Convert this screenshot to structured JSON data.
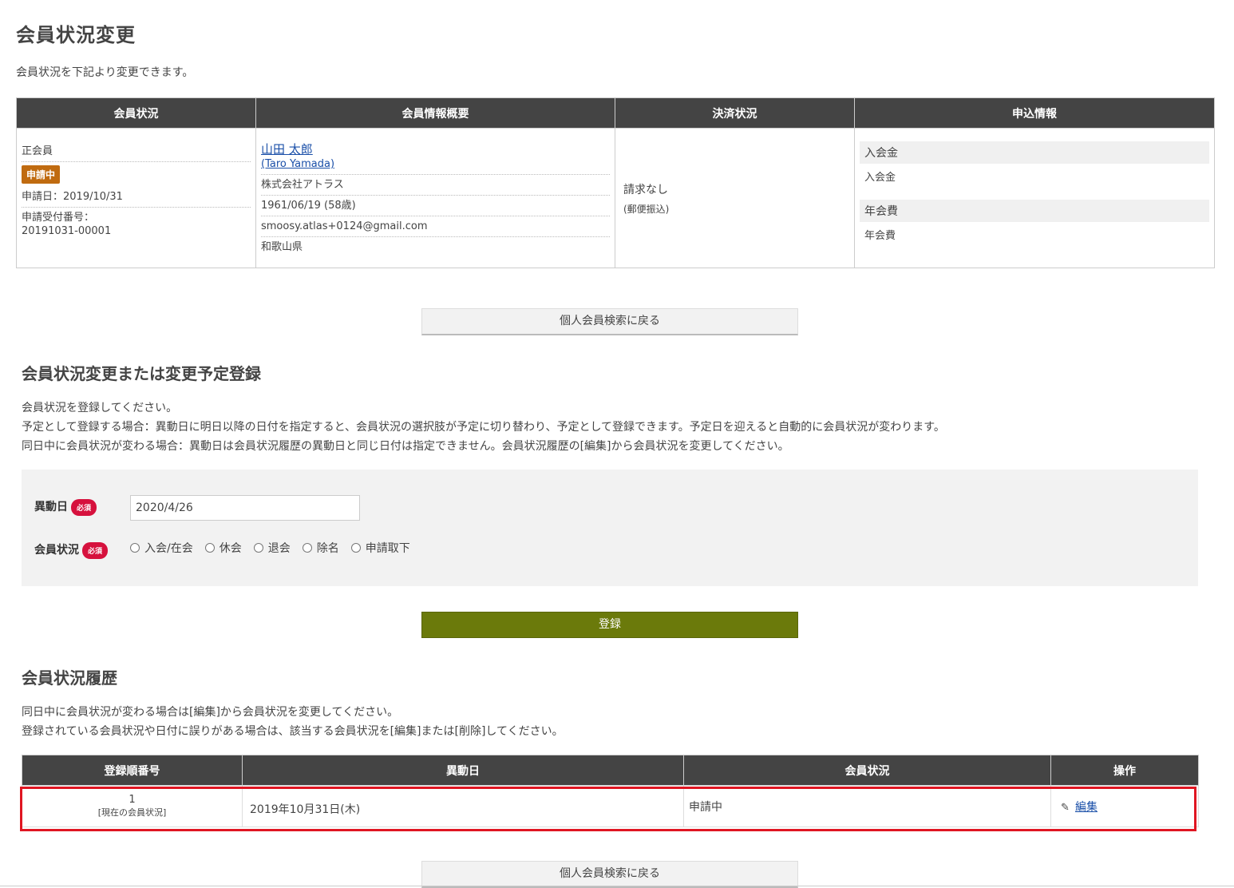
{
  "page": {
    "title": "会員状況変更",
    "description": "会員状況を下記より変更できます。"
  },
  "info_table": {
    "headers": [
      "会員状況",
      "会員情報概要",
      "決済状況",
      "申込情報"
    ],
    "status": {
      "type": "正会員",
      "badge": "申請中",
      "applied_date": "申請日：2019/10/31",
      "receipt_label": "申請受付番号：",
      "receipt_number": "20191031-00001"
    },
    "member": {
      "name": "山田 太郎",
      "name_en": "(Taro Yamada)",
      "company": "株式会社アトラス",
      "birth": "1961/06/19 (58歳)",
      "email": "smoosy.atlas+0124@gmail.com",
      "prefecture": "和歌山県"
    },
    "payment": {
      "status": "請求なし",
      "method": "(郵便振込)"
    },
    "application": [
      {
        "heading": "入会金",
        "value": "入会金"
      },
      {
        "heading": "年会費",
        "value": "年会費"
      }
    ]
  },
  "back_button": "個人会員検索に戻る",
  "change_section": {
    "title": "会員状況変更または変更予定登録",
    "lines": [
      "会員状況を登録してください。",
      "予定として登録する場合：異動日に明日以降の日付を指定すると、会員状況の選択肢が予定に切り替わり、予定として登録できます。予定日を迎えると自動的に会員状況が変わります。",
      "同日中に会員状況が変わる場合：異動日は会員状況履歴の異動日と同じ日付は指定できません。会員状況履歴の[編集]から会員状況を変更してください。"
    ]
  },
  "form": {
    "date_label": "異動日",
    "status_label": "会員状況",
    "required": "必須",
    "date_value": "2020/4/26",
    "options": [
      "入会/在会",
      "休会",
      "退会",
      "除名",
      "申請取下"
    ]
  },
  "submit_button": "登録",
  "history_section": {
    "title": "会員状況履歴",
    "lines": [
      "同日中に会員状況が変わる場合は[編集]から会員状況を変更してください。",
      "登録されている会員状況や日付に誤りがある場合は、該当する会員状況を[編集]または[削除]してください。"
    ],
    "headers": [
      "登録順番号",
      "異動日",
      "会員状況",
      "操作"
    ],
    "rows": [
      {
        "number": "1",
        "note": "[現在の会員状況]",
        "date": "2019年10月31日(木)",
        "status": "申請中",
        "action": "編集"
      }
    ]
  },
  "colors": {
    "header_bg": "#444444",
    "badge": "#c06b10",
    "required": "#d6113d",
    "submit": "#6b7a0b",
    "highlight": "#e01622",
    "link": "#1a4fa8"
  }
}
